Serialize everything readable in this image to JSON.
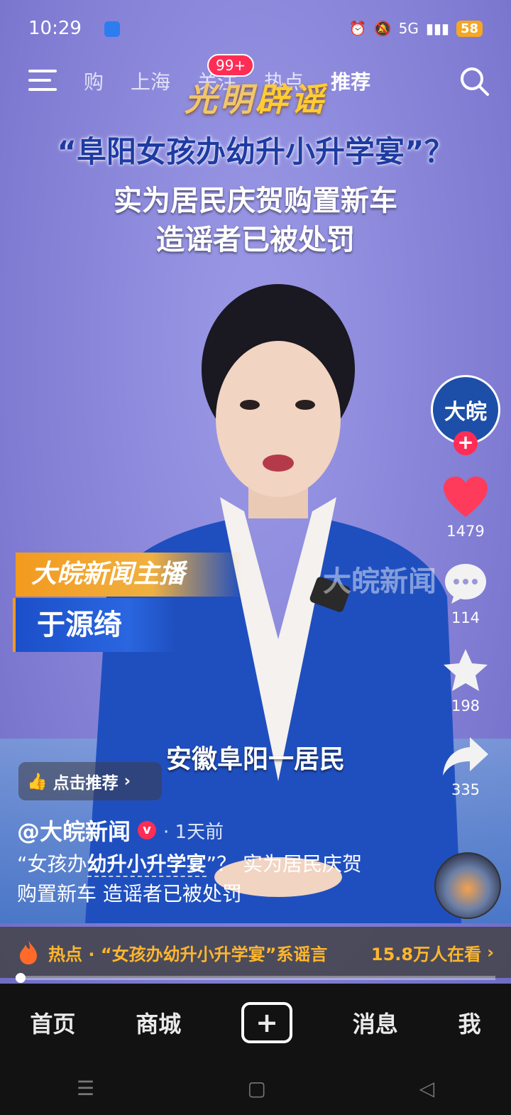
{
  "status_bar": {
    "time": "10:29",
    "network": "5G",
    "battery": "58"
  },
  "top_nav": {
    "tabs": [
      "购",
      "上海",
      "关注",
      "热点",
      "推荐"
    ],
    "active_tab": "推荐",
    "badge": "99+"
  },
  "video": {
    "brand_part1": "光明",
    "brand_part2": "辟谣",
    "headline_1": "“阜阳女孩办幼升小升学宴”？",
    "headline_2": "实为居民庆贺购置新车",
    "headline_3": "造谣者已被处罚",
    "lower_third_title": "大皖新闻主播",
    "lower_third_name": "于源绮",
    "watermark": "大皖新闻",
    "subtitle": "安徽阜阳一居民"
  },
  "actions": {
    "avatar_text": "大皖",
    "likes": "1479",
    "comments": "114",
    "favorites": "198",
    "shares": "335"
  },
  "recommend_label": "点击推荐",
  "author": {
    "name": "@大皖新闻",
    "time_ago": "· 1天前"
  },
  "caption": {
    "part1": "“女孩办",
    "highlight": "幼升小升学宴",
    "part2": "”？  实为居民庆贺购置新车 造谣者已被处罚"
  },
  "hot_bar": {
    "text": "热点 · “女孩办幼升小升学宴”系谣言",
    "viewers": "15.8万人在看"
  },
  "playback_progress": 0.01,
  "bottom_nav": {
    "home": "首页",
    "mall": "商城",
    "messages": "消息",
    "me": "我"
  },
  "colors": {
    "like_red": "#ff3b5c",
    "hot_orange": "#ffb62e",
    "accent_pink": "#ff2d55"
  }
}
